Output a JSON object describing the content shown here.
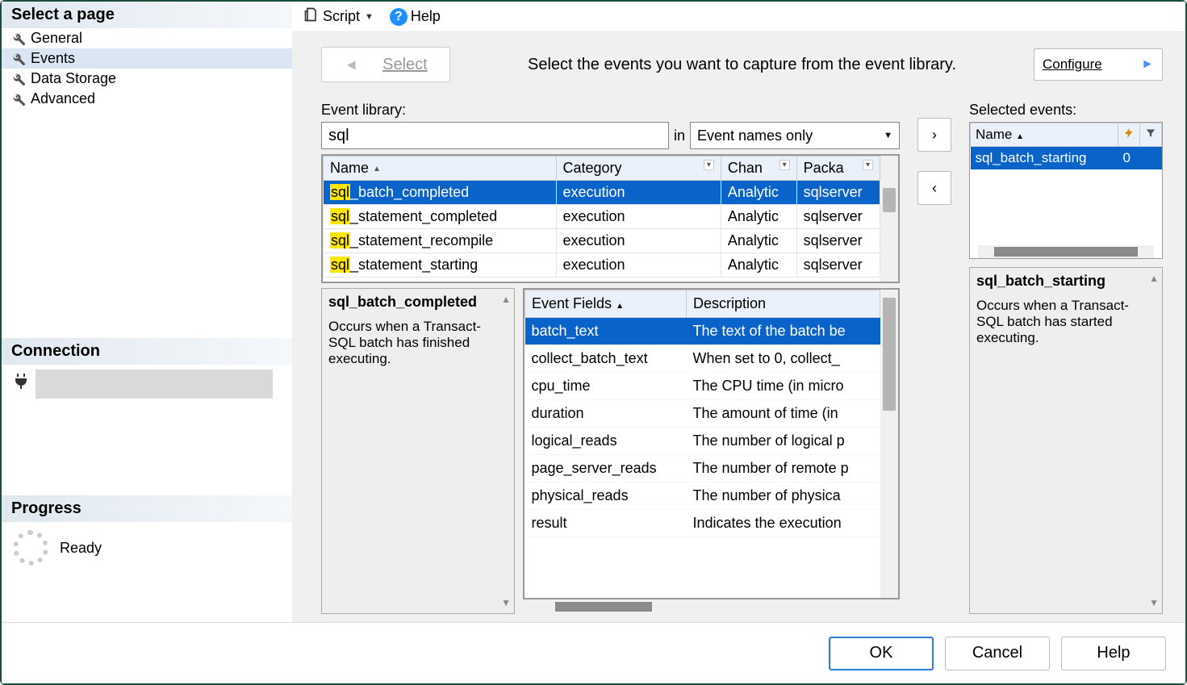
{
  "sidebar": {
    "header": "Select a page",
    "items": [
      "General",
      "Events",
      "Data Storage",
      "Advanced"
    ],
    "selected_index": 1,
    "connection_header": "Connection",
    "progress_header": "Progress",
    "progress_status": "Ready"
  },
  "toolbar": {
    "script_label": "Script",
    "help_label": "Help"
  },
  "top": {
    "back_label": "Select",
    "instruction": "Select the events you want to capture from the event library.",
    "configure_label": "Configure"
  },
  "library": {
    "label": "Event library:",
    "search_value": "sql",
    "in_label": "in",
    "filter_mode": "Event names only",
    "columns": {
      "name": "Name",
      "category": "Category",
      "channel": "Chan",
      "package": "Packa"
    },
    "rows": [
      {
        "name_hl": "sql",
        "name_rest": "_batch_completed",
        "category": "execution",
        "channel": "Analytic",
        "package": "sqlserver",
        "selected": true
      },
      {
        "name_hl": "sql",
        "name_rest": "_statement_completed",
        "category": "execution",
        "channel": "Analytic",
        "package": "sqlserver",
        "selected": false
      },
      {
        "name_hl": "sql",
        "name_rest": "_statement_recompile",
        "category": "execution",
        "channel": "Analytic",
        "package": "sqlserver",
        "selected": false
      },
      {
        "name_hl": "sql",
        "name_rest": "_statement_starting",
        "category": "execution",
        "channel": "Analytic",
        "package": "sqlserver",
        "selected": false
      }
    ]
  },
  "detail_left": {
    "title": "sql_batch_completed",
    "desc": "Occurs when a Transact-SQL batch has finished executing."
  },
  "fields": {
    "header_name": "Event Fields",
    "header_desc": "Description",
    "rows": [
      {
        "name": "batch_text",
        "desc": "The text of the batch be",
        "selected": true
      },
      {
        "name": "collect_batch_text",
        "desc": "When set to 0, collect_",
        "selected": false
      },
      {
        "name": "cpu_time",
        "desc": "The CPU time (in micro",
        "selected": false
      },
      {
        "name": "duration",
        "desc": "The amount of time (in ",
        "selected": false
      },
      {
        "name": "logical_reads",
        "desc": "The number of logical p",
        "selected": false
      },
      {
        "name": "page_server_reads",
        "desc": "The number of remote p",
        "selected": false
      },
      {
        "name": "physical_reads",
        "desc": "The number of physica",
        "selected": false
      },
      {
        "name": "result",
        "desc": "Indicates the execution",
        "selected": false
      }
    ]
  },
  "selected_panel": {
    "label": "Selected events:",
    "col_name": "Name",
    "rows": [
      {
        "name": "sql_batch_starting",
        "count": "0",
        "selected": true
      }
    ],
    "detail_title": "sql_batch_starting",
    "detail_desc": "Occurs when a Transact-SQL batch has started executing."
  },
  "buttons": {
    "ok": "OK",
    "cancel": "Cancel",
    "help": "Help"
  }
}
